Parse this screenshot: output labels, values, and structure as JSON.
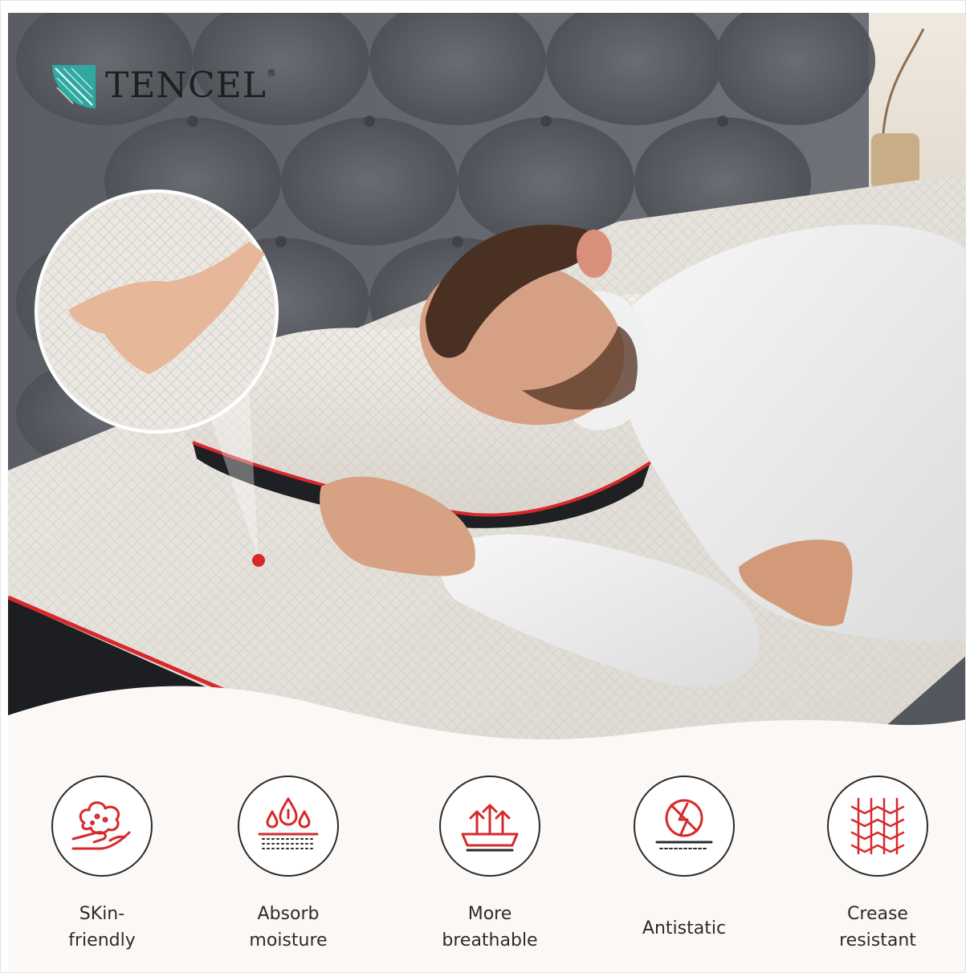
{
  "brand": {
    "logo_text": "TENCEL",
    "logo_mark_symbol": "®",
    "logo_icon": "leaf-icon",
    "accent_color": "#d7292b"
  },
  "hero": {
    "description_icons": [
      "magnifier-callout-icon",
      "callout-dot-icon"
    ]
  },
  "features": [
    {
      "label": "SKin-\nfriendly",
      "icon": "skin-friendly-icon"
    },
    {
      "label": "Absorb\nmoisture",
      "icon": "absorb-moisture-icon"
    },
    {
      "label": "More\nbreathable",
      "icon": "breathable-icon"
    },
    {
      "label": "Antistatic",
      "icon": "antistatic-icon"
    },
    {
      "label": "Crease\nresistant",
      "icon": "crease-resistant-icon"
    }
  ]
}
